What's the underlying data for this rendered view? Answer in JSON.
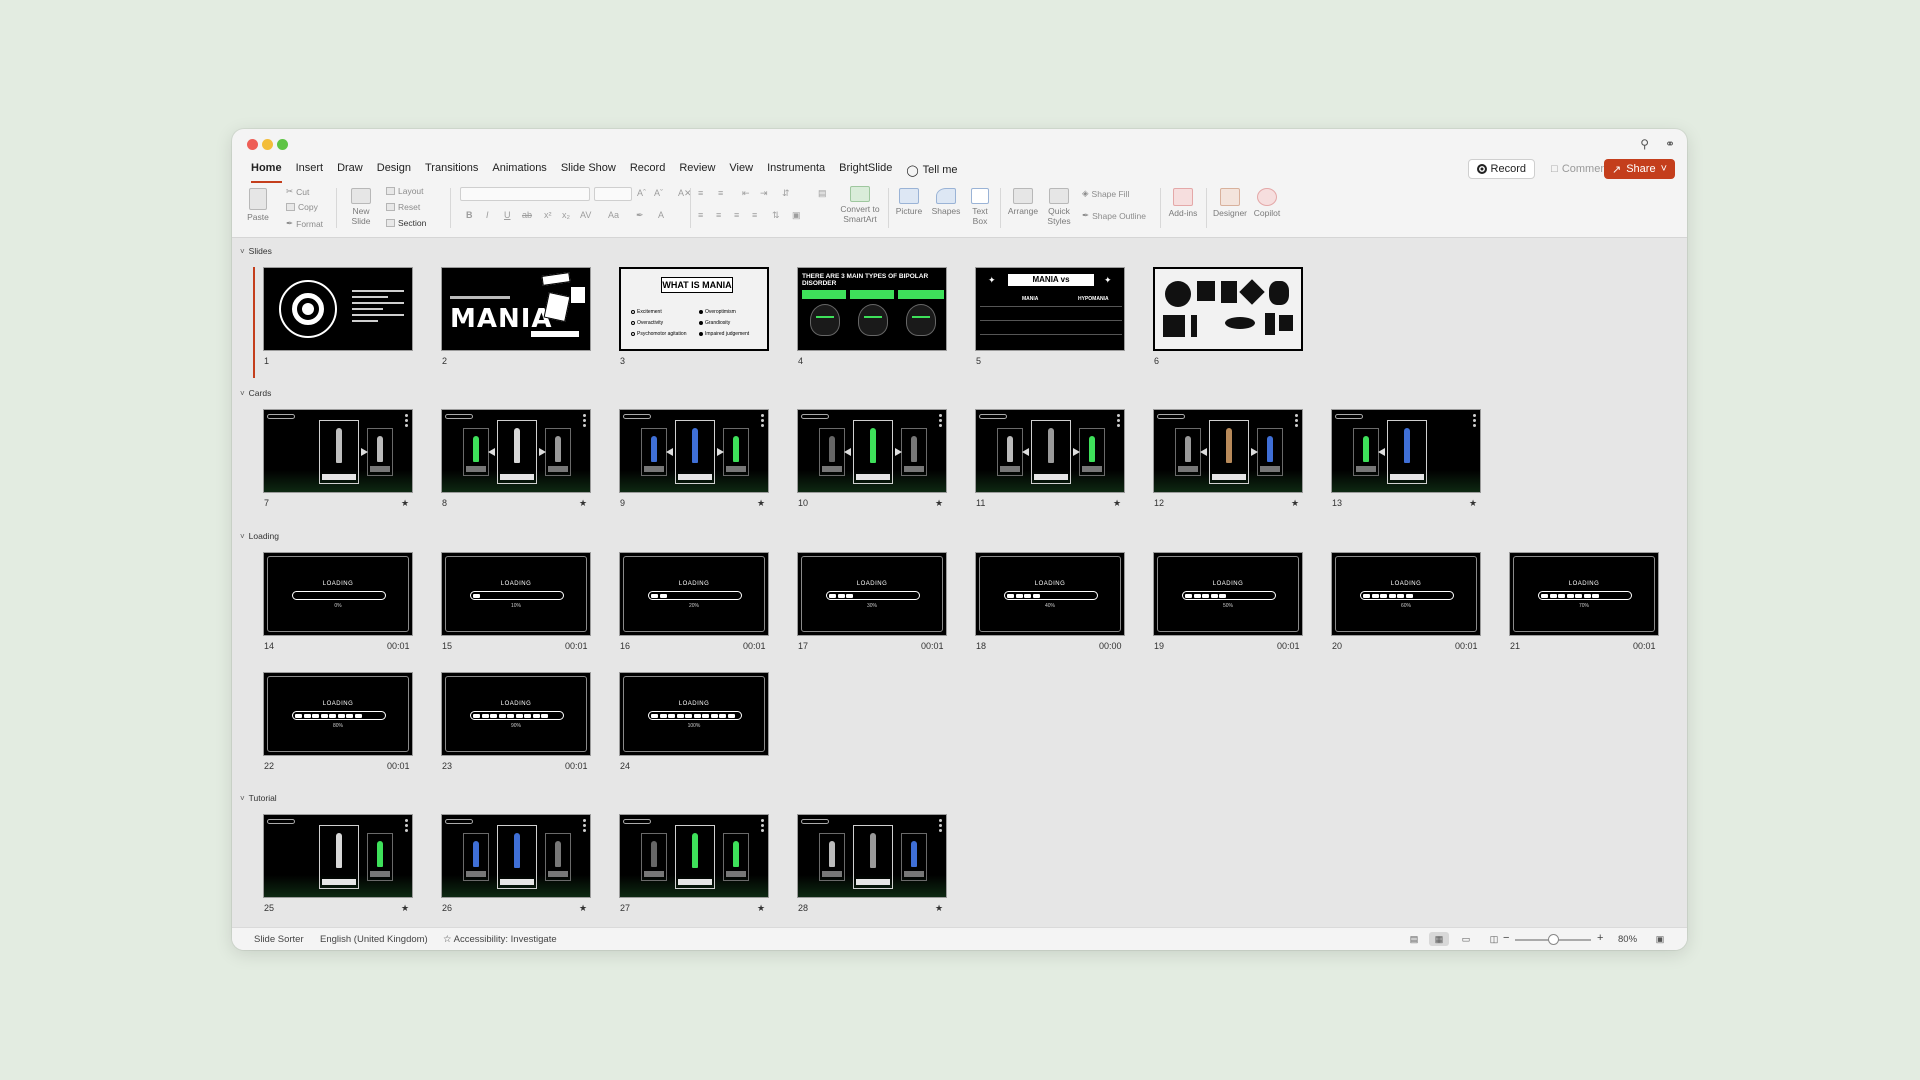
{
  "ribbon_tabs": [
    "Home",
    "Insert",
    "Draw",
    "Design",
    "Transitions",
    "Animations",
    "Slide Show",
    "Record",
    "Review",
    "View",
    "Instrumenta",
    "BrightSlide"
  ],
  "tell_me": "Tell me",
  "record_label": "Record",
  "comments_label": "Comments",
  "share_label": "Share",
  "ribbon": {
    "paste": "Paste",
    "cut": "Cut",
    "copy": "Copy",
    "format": "Format",
    "new_slide_1": "New",
    "new_slide_2": "Slide",
    "layout": "Layout",
    "reset": "Reset",
    "section": "Section",
    "convert_smartart_1": "Convert to",
    "convert_smartart_2": "SmartArt",
    "picture": "Picture",
    "shapes": "Shapes",
    "text_box_1": "Text",
    "text_box_2": "Box",
    "arrange": "Arrange",
    "quick_styles_1": "Quick",
    "quick_styles_2": "Styles",
    "shape_fill": "Shape Fill",
    "shape_outline": "Shape Outline",
    "add_ins": "Add-ins",
    "designer": "Designer",
    "copilot": "Copilot"
  },
  "sections": {
    "slides": "Slides",
    "cards": "Cards",
    "loading": "Loading",
    "tutorial": "Tutorial"
  },
  "slides_section": {
    "numbers": [
      "1",
      "2",
      "3",
      "4",
      "5",
      "6"
    ],
    "s2_title": "MANIA",
    "s3_title": "WHAT IS MANIA",
    "s3_items": [
      "Excitement",
      "Overactivity",
      "Psychomotor agitation",
      "Overoptimism",
      "Grandiosity",
      "Impaired judgement"
    ],
    "s4_title": "THERE ARE 3 MAIN TYPES OF BIPOLAR DISORDER",
    "s5_title": "MANIA vs HYPOMANIA",
    "s5_cols": [
      "MANIA",
      "HYPOMANIA"
    ]
  },
  "cards_section": {
    "numbers": [
      "7",
      "8",
      "9",
      "10",
      "11",
      "12",
      "13"
    ],
    "star_label": "★"
  },
  "loading_section": {
    "title": "LOADING",
    "slides": [
      {
        "num": "14",
        "dur": "00:01",
        "pct": "0%",
        "fill": 0
      },
      {
        "num": "15",
        "dur": "00:01",
        "pct": "10%",
        "fill": 1
      },
      {
        "num": "16",
        "dur": "00:01",
        "pct": "20%",
        "fill": 2
      },
      {
        "num": "17",
        "dur": "00:01",
        "pct": "30%",
        "fill": 3
      },
      {
        "num": "18",
        "dur": "00:00",
        "pct": "40%",
        "fill": 4
      },
      {
        "num": "19",
        "dur": "00:01",
        "pct": "50%",
        "fill": 5
      },
      {
        "num": "20",
        "dur": "00:01",
        "pct": "60%",
        "fill": 6
      },
      {
        "num": "21",
        "dur": "00:01",
        "pct": "70%",
        "fill": 7
      },
      {
        "num": "22",
        "dur": "00:01",
        "pct": "80%",
        "fill": 8
      },
      {
        "num": "23",
        "dur": "00:01",
        "pct": "90%",
        "fill": 9
      },
      {
        "num": "24",
        "dur": "",
        "pct": "100%",
        "fill": 10
      }
    ]
  },
  "tutorial_section": {
    "numbers": [
      "25",
      "26",
      "27",
      "28"
    ]
  },
  "statusbar": {
    "view_name": "Slide Sorter",
    "language": "English (United Kingdom)",
    "accessibility": "Accessibility: Investigate",
    "zoom": "80%"
  },
  "colors": {
    "accent": "#c43e1c",
    "green": "#3ee05a",
    "blue": "#3f6fd6"
  }
}
